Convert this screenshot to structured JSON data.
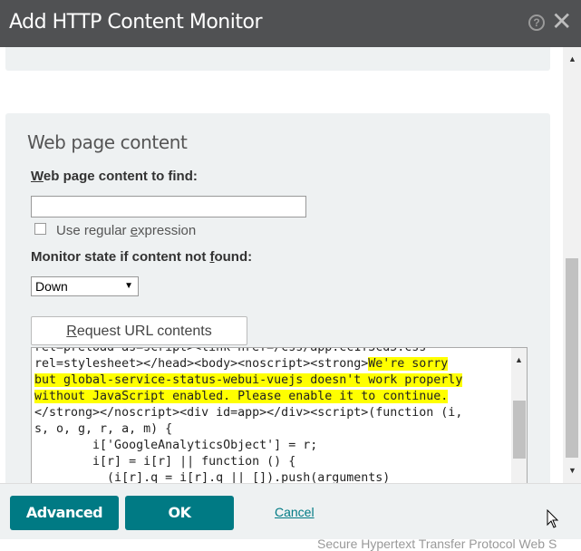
{
  "dialog": {
    "title": "Add HTTP Content Monitor",
    "help_icon": "?",
    "close_icon": "✕"
  },
  "section": {
    "heading": "Web page content"
  },
  "content_to_find": {
    "label_pre": "",
    "label_underlined": "W",
    "label_post": "eb page content to find:",
    "value": ""
  },
  "regex": {
    "label_pre": "Use regular ",
    "label_underlined": "e",
    "label_post": "xpression",
    "checked": false
  },
  "state": {
    "label_pre": "Monitor state if content not ",
    "label_underlined": "f",
    "label_post": "ound:",
    "selected": "Down"
  },
  "request_button": {
    "label_underlined": "R",
    "label_post": "equest URL contents"
  },
  "response": {
    "line0": "rel=preload as=script><link href=/css/app.cc1f3cd5.css",
    "line1_pre": "rel=stylesheet></head><body><noscript><strong>",
    "line1_hl": "We're sorry",
    "line2_hl": "but global-service-status-webui-vuejs doesn't work properly",
    "line3_hl": "without JavaScript enabled. Please enable it to continue.",
    "line4": "</strong></noscript><div id=app></div><script>(function (i,",
    "line5": "s, o, g, r, a, m) {",
    "line6": "        i['GoogleAnalyticsObject'] = r;",
    "line7": "        i[r] = i[r] || function () {",
    "line8": "          (i[r].q = i[r].q || []).push(arguments)",
    "highlight_color": "#ffff00"
  },
  "footer": {
    "advanced": "Advanced",
    "ok": "OK",
    "cancel": "Cancel",
    "background_text": "Secure Hypertext Transfer Protocol Web S"
  },
  "colors": {
    "titlebar": "#505153",
    "primary": "#007a84",
    "panel": "#eef1f2"
  }
}
